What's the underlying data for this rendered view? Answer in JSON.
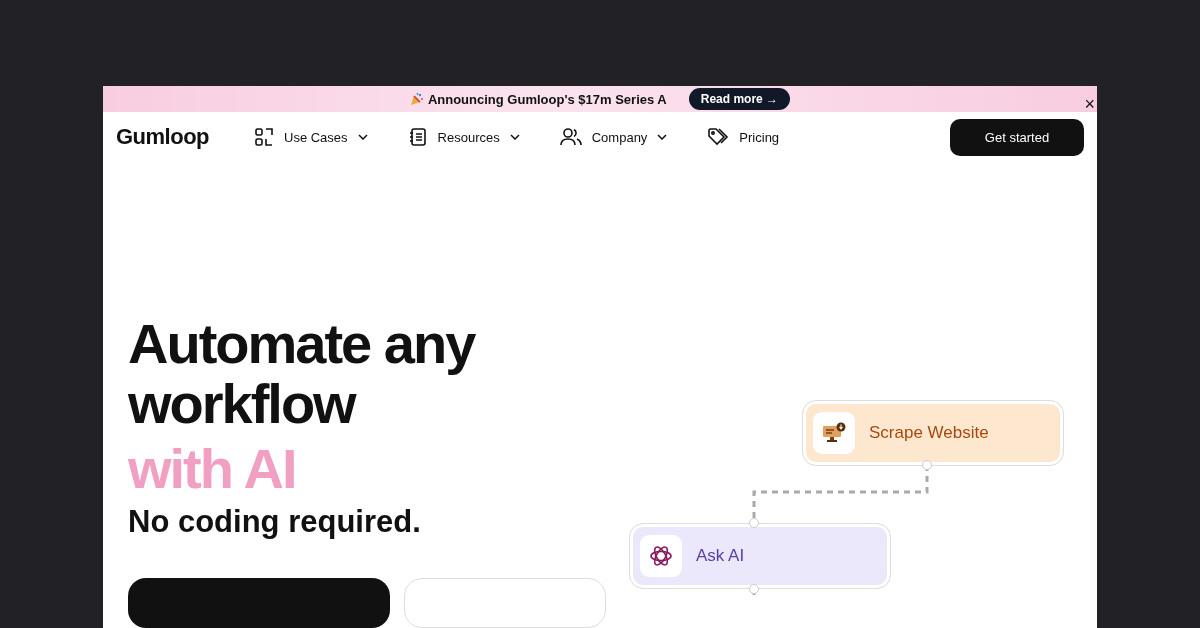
{
  "banner": {
    "text": "Announcing Gumloop's $17m Series A",
    "link": "Read more →",
    "close": "×"
  },
  "nav": {
    "logo": "Gumloop",
    "items": [
      {
        "label": "Use Cases",
        "kind": "cases",
        "has_menu": true
      },
      {
        "label": "Resources",
        "kind": "resources",
        "has_menu": true
      },
      {
        "label": "Company",
        "kind": "company",
        "has_menu": true
      },
      {
        "label": "Pricing",
        "kind": "pricing",
        "has_menu": false
      }
    ],
    "cta": "Get started"
  },
  "hero": {
    "title": "Automate any workflow",
    "highlight": "with AI",
    "subtitle": "No coding required."
  },
  "flow": {
    "nodes": [
      {
        "label": "Scrape Website",
        "kind": "scrape"
      },
      {
        "label": "Ask AI",
        "kind": "ai"
      }
    ]
  }
}
